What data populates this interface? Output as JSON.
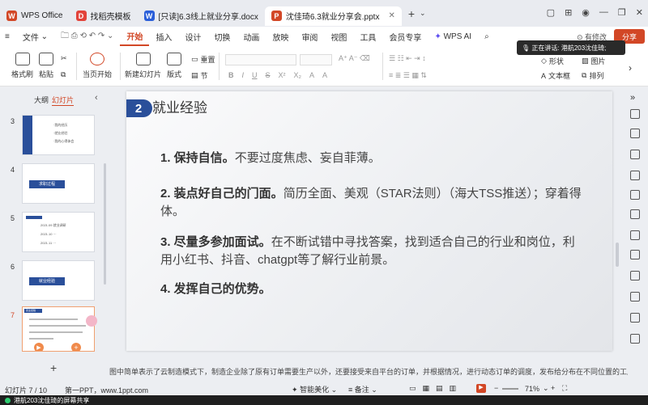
{
  "tabs": [
    {
      "label": "WPS Office",
      "icon": "wps-logo-icon",
      "color": "#d24726"
    },
    {
      "label": "找稻壳模板",
      "icon": "docer-icon",
      "color": "#e2433a"
    },
    {
      "label": "[只读]6.3线上就业分享.docx",
      "icon": "word-doc-icon",
      "color": "#2b5fd9"
    },
    {
      "label": "沈佳琦6.3就业分享会.pptx",
      "icon": "ppt-icon",
      "color": "#d24726"
    }
  ],
  "menu": {
    "file": "文件",
    "items": [
      "开始",
      "插入",
      "设计",
      "切换",
      "动画",
      "放映",
      "审阅",
      "视图",
      "工具",
      "会员专享"
    ],
    "wps_ai": "WPS AI",
    "edited": "有修改",
    "share": "分享"
  },
  "ribbon": {
    "format_painter": "格式刷",
    "paste": "粘贴",
    "play_current": "当页开始",
    "new_slide": "新建幻灯片",
    "layout": "版式",
    "section": "节",
    "reset": "重置",
    "shape": "形状",
    "picture": "图片",
    "textbox": "文本框",
    "arrange": "排列"
  },
  "speaking_toast": "正在讲话: 港航203沈佳琦;",
  "panel_tabs": {
    "outline": "大纲",
    "slides": "幻灯片"
  },
  "thumbs": [
    {
      "num": "3",
      "lines": [
        "·我的经历",
        "·就业经验",
        "·我的心得体会"
      ]
    },
    {
      "num": "4",
      "title": "求职过程"
    },
    {
      "num": "5",
      "lines": [
        "2021.09   就业调研",
        "2021.10   ···",
        "2021.11   ···"
      ]
    },
    {
      "num": "6",
      "title": "就业经验"
    },
    {
      "num": "7",
      "title": "就业经验"
    }
  ],
  "slide": {
    "section_num": "2",
    "section_title": "就业经验",
    "points": [
      {
        "bold": "1. 保持自信。",
        "text": "不要过度焦虑、妄自菲薄。"
      },
      {
        "bold": "2. 装点好自己的门面。",
        "text": "简历全面、美观（STAR法则）（海大TSS推送）；穿着得体。"
      },
      {
        "bold": "3. 尽量多参加面试。",
        "text": "在不断试错中寻找答案，找到适合自己的行业和岗位，利用小红书、抖音、chatgpt等了解行业前景。"
      },
      {
        "bold": "4. 发挥自己的优势。",
        "text": ""
      }
    ]
  },
  "notes": "图中简单表示了云制造模式下，制造企业除了原有订单需要生产以外，还要接受来自平台的订单，并根据情况，进行动态订单的调度，发布给分布在不同位置的工厂去加工制造。",
  "status": {
    "slide_counter": "幻灯片 7 / 10",
    "template": "第一PPT，www.1ppt.com",
    "smart_beautify": "智能美化",
    "remarks": "备注",
    "zoom": "71%"
  },
  "share_bar": "港航203沈佳琦的屏幕共享",
  "colors": {
    "accent": "#d24726",
    "slide_badge": "#2a4f9a"
  }
}
